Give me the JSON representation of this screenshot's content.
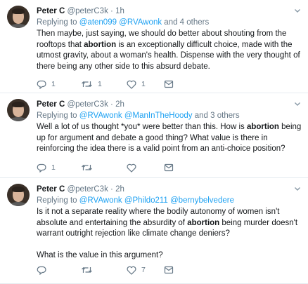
{
  "tweets": [
    {
      "name": "Peter C",
      "handle": "@peterC3k",
      "dot": "·",
      "time": "1h",
      "reply_prefix": "Replying to",
      "reply_mentions": "@aten099 @RVAwonk",
      "reply_suffix": "and 4 others",
      "body_pre": "Then maybe, just saying, we should do better about shouting from the rooftops that ",
      "body_bold": "abortion",
      "body_post": " is an exceptionally difficult choice, made with the utmost gravity, about a woman's health. Dispense with the very thought of there being any other side to this absurd debate.",
      "reply_count": "1",
      "retweet_count": "1",
      "like_count": "1"
    },
    {
      "name": "Peter C",
      "handle": "@peterC3k",
      "dot": "·",
      "time": "2h",
      "reply_prefix": "Replying to",
      "reply_mentions": "@RVAwonk @ManInTheHoody",
      "reply_suffix": "and 3 others",
      "body_pre": "Well a lot of us thought *you* were better than this. How is ",
      "body_bold": "abortion",
      "body_post": " being up for argument and debate a good thing? What value is there in reinforcing the idea there is a valid point from an anti-choice position?",
      "reply_count": "1",
      "retweet_count": "",
      "like_count": ""
    },
    {
      "name": "Peter C",
      "handle": "@peterC3k",
      "dot": "·",
      "time": "2h",
      "reply_prefix": "Replying to",
      "reply_mentions": "@RVAwonk @Phildo211 @bernybelvedere",
      "reply_suffix": "",
      "body_pre": "Is it not a separate reality where the bodily autonomy of women isn't absolute and entertaining the absurdity of ",
      "body_bold": "abortion",
      "body_post": " being murder doesn't warrant outright rejection like climate change deniers?",
      "body_extra": "What is the value in this argument?",
      "reply_count": "",
      "retweet_count": "",
      "like_count": "7"
    }
  ],
  "icons": {
    "reply": "reply-icon",
    "retweet": "retweet-icon",
    "like": "like-icon",
    "dm": "direct-message-icon",
    "caret": "chevron-down-icon"
  },
  "colors": {
    "link": "#1da1f2",
    "muted": "#657786",
    "text": "#14171a",
    "divider": "#e6ecf0"
  }
}
